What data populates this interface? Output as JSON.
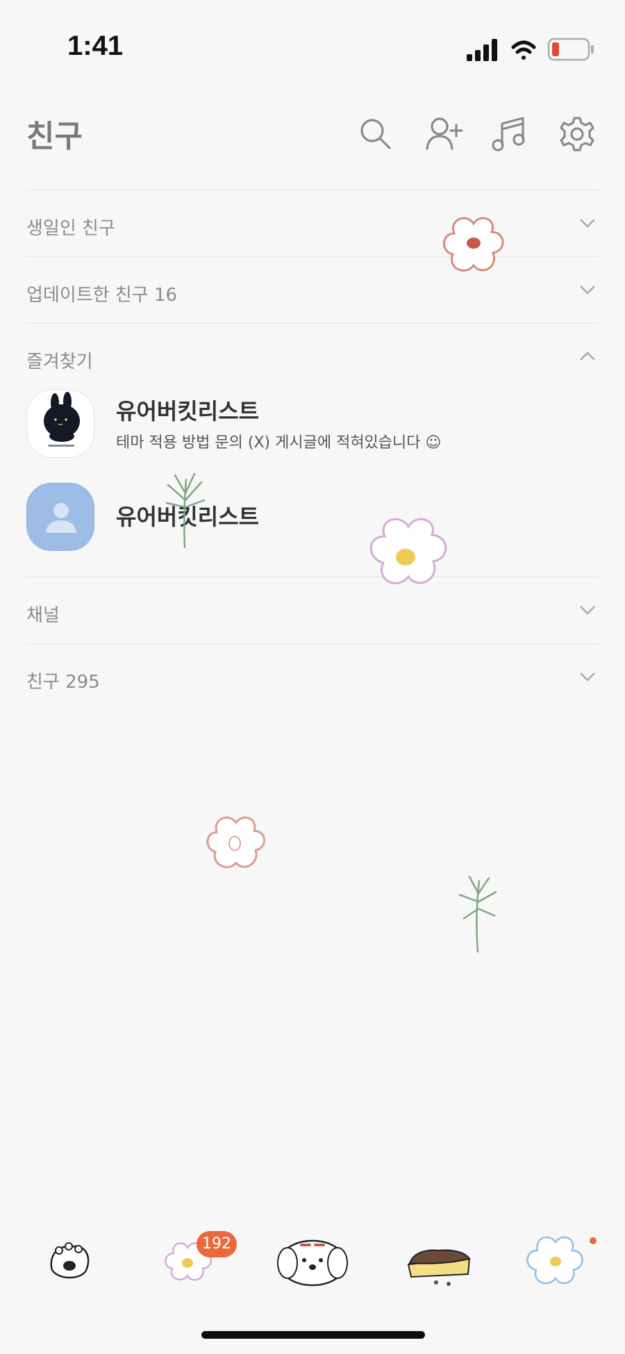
{
  "status_bar": {
    "time": "1:41"
  },
  "header": {
    "title": "친구",
    "icons": [
      "search-icon",
      "add-friend-icon",
      "music-icon",
      "settings-icon"
    ]
  },
  "sections": {
    "birthday": "생일인 친구",
    "updated": "업데이트한 친구 16",
    "favorites": "즐겨찾기",
    "channels": "채널",
    "friends": "친구 295"
  },
  "favorites": [
    {
      "name": "유어버킷리스트",
      "status": "테마 적용 방법 문의 (X) 게시글에 적혀있습니다 ☺"
    },
    {
      "name": "유어버킷리스트",
      "status": ""
    }
  ],
  "bottom_tabs": {
    "badge_count": "192",
    "tabs": [
      "friends-tab",
      "chats-tab",
      "view-tab",
      "shopping-tab",
      "more-tab"
    ]
  },
  "colors": {
    "background": "#f7f7f7",
    "badge": "#e8693c",
    "battery_low": "#e04a3a",
    "avatar_blue": "#9dbde6"
  }
}
